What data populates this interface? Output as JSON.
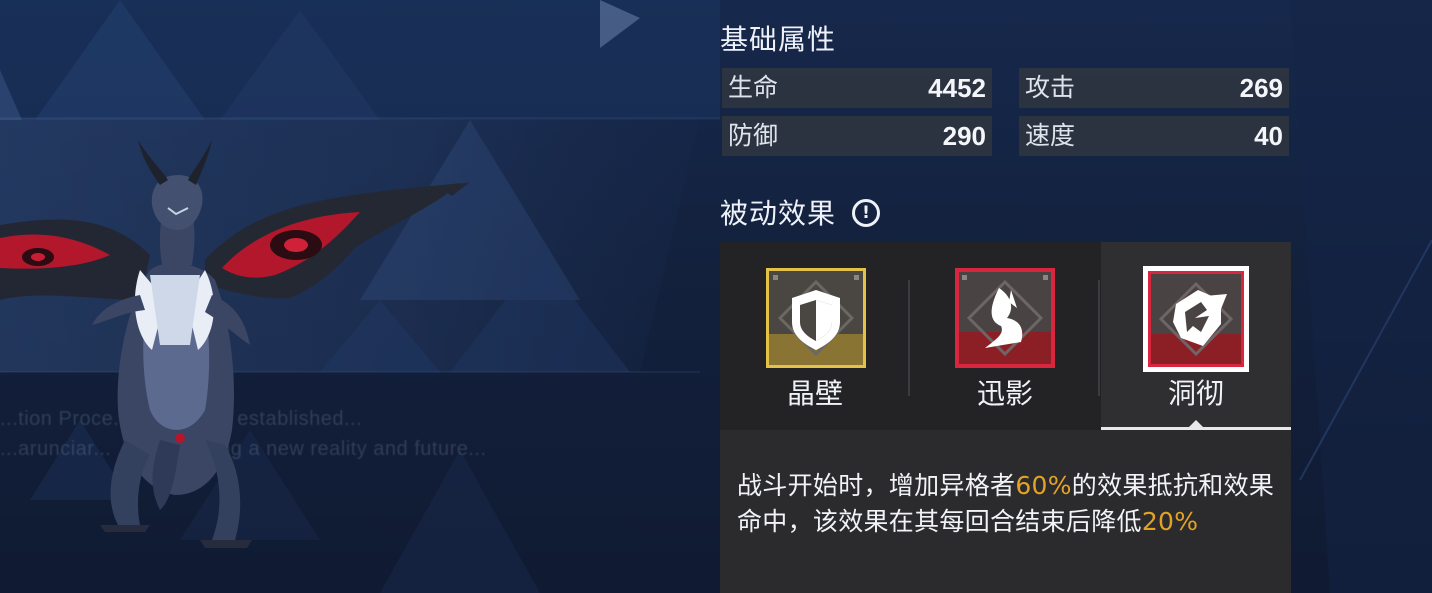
{
  "colors": {
    "highlight": "#e4a224",
    "gold_frame": "#e4c24a",
    "red_frame": "#d7263d",
    "white_frame": "#ffffff",
    "panel_dark": "#232325",
    "stat_box": "#30363f"
  },
  "lore_lines": [
    "...tion Proce... ...ola' was established...",
    "...arunciar... ...es, seeking a new reality and future..."
  ],
  "base_attributes": {
    "title": "基础属性",
    "stats": [
      {
        "label": "生命",
        "value": "4452"
      },
      {
        "label": "攻击",
        "value": "269"
      },
      {
        "label": "防御",
        "value": "290"
      },
      {
        "label": "速度",
        "value": "40"
      }
    ]
  },
  "passive": {
    "title": "被动效果",
    "info_icon": "info-icon",
    "skills": [
      {
        "name": "晶壁",
        "icon": "shield-icon",
        "frame": "gold",
        "active": false
      },
      {
        "name": "迅影",
        "icon": "dash-icon",
        "frame": "red",
        "active": false
      },
      {
        "name": "洞彻",
        "icon": "insight-icon",
        "frame": "red-white",
        "active": true
      }
    ],
    "selected_description": {
      "pre": "战斗开始时，增加异格者",
      "value1": "60%",
      "mid": "的效果抵抗和效果命中，该效果在其每回合结束后降低",
      "value2": "20%"
    }
  }
}
